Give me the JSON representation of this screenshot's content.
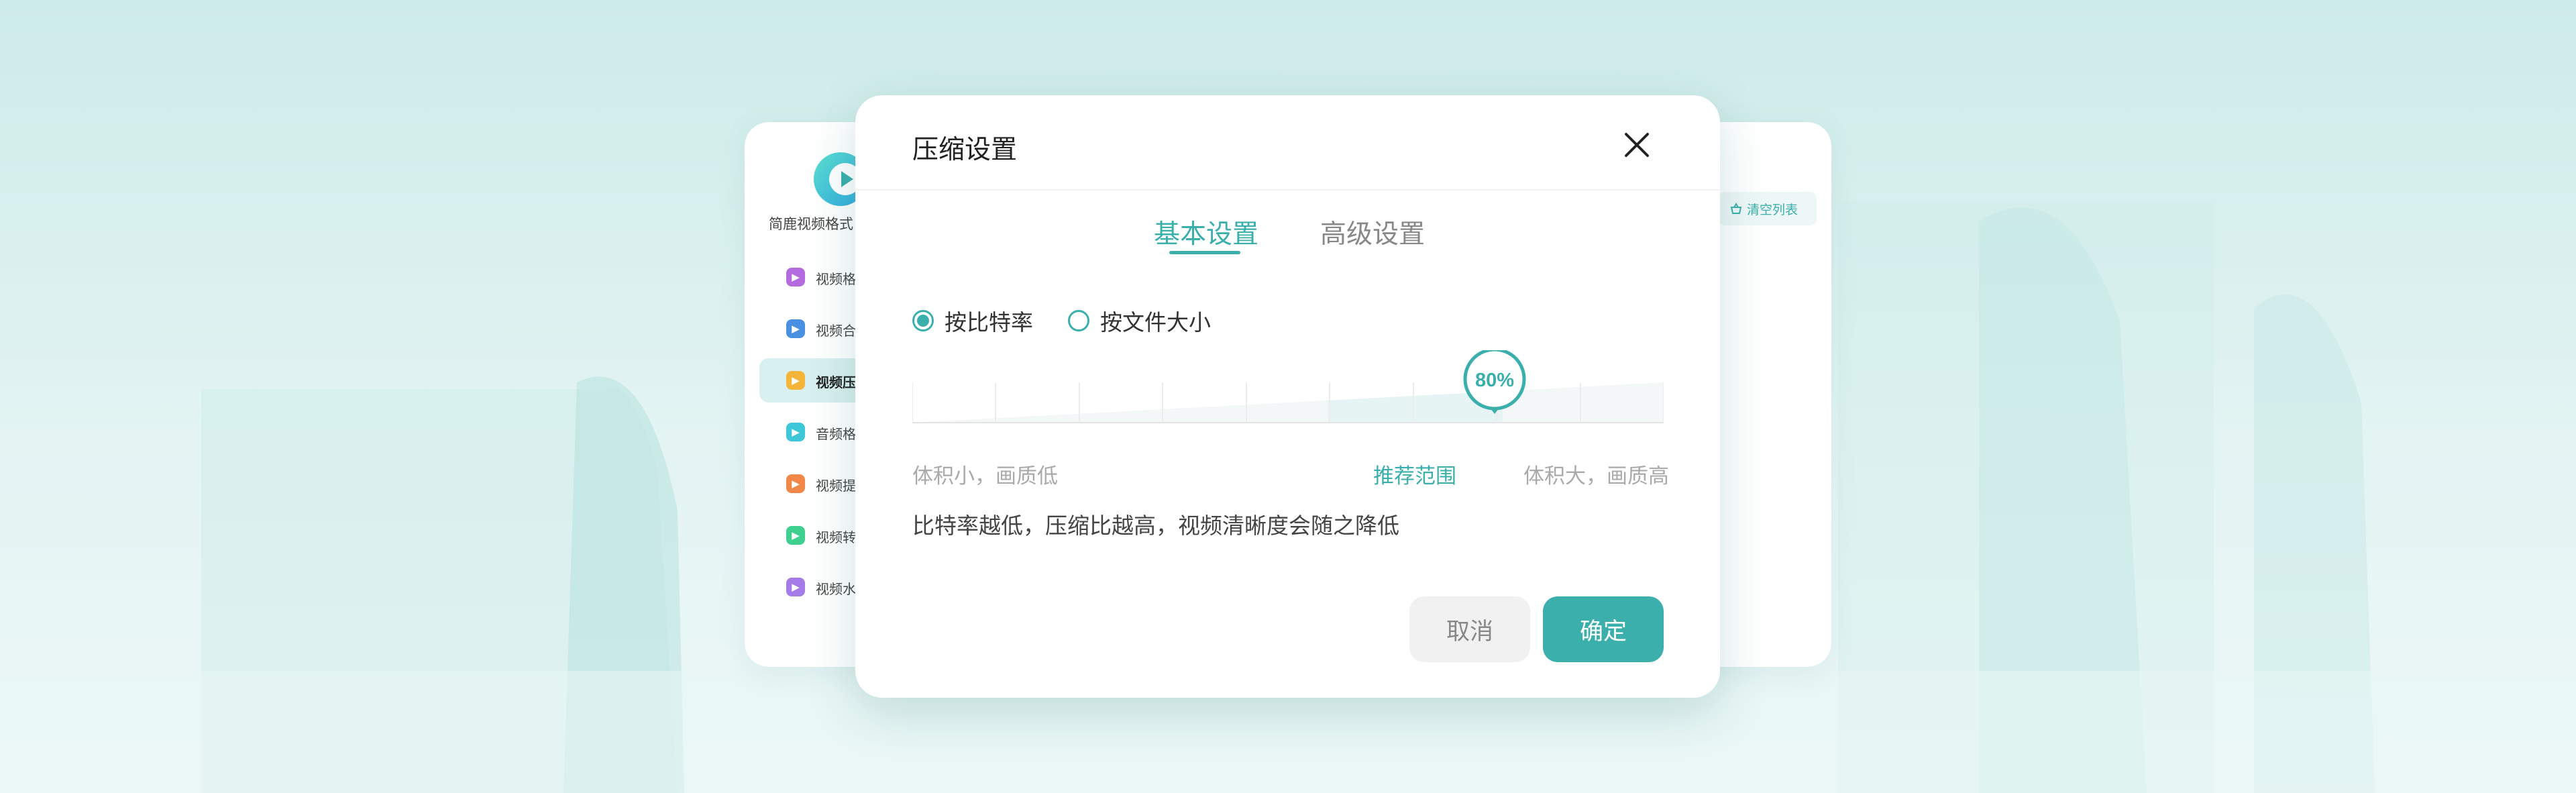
{
  "back_window": {
    "app_name": "简鹿视频格式",
    "sidebar_items": [
      {
        "label": "视频格式",
        "icon": "video-format-icon",
        "color": "#b56be0"
      },
      {
        "label": "视频合并",
        "icon": "video-merge-icon",
        "color": "#4a90e2"
      },
      {
        "label": "视频压缩",
        "icon": "video-compress-icon",
        "color": "#f5b43a"
      },
      {
        "label": "音频格式",
        "icon": "audio-format-icon",
        "color": "#3ec6d9"
      },
      {
        "label": "视频提取",
        "icon": "video-extract-icon",
        "color": "#f2874a"
      },
      {
        "label": "视频转G",
        "icon": "video-to-gif-icon",
        "color": "#3fcf8e"
      },
      {
        "label": "视频水印",
        "icon": "video-watermark-icon",
        "color": "#a57be8"
      }
    ],
    "active_index": 2,
    "clear_list_label": "清空列表"
  },
  "dialog": {
    "title": "压缩设置",
    "tabs": [
      {
        "label": "基本设置",
        "active": true
      },
      {
        "label": "高级设置",
        "active": false
      }
    ],
    "radio_options": [
      {
        "label": "按比特率",
        "selected": true
      },
      {
        "label": "按文件大小",
        "selected": false
      }
    ],
    "slider": {
      "value_label": "80%",
      "value": 0.7,
      "segments": 9,
      "left_label": "体积小，画质低",
      "recommended_label": "推荐范围",
      "right_label": "体积大，画质高"
    },
    "description": "比特率越低，压缩比越高，视频清晰度会随之降低",
    "cancel_label": "取消",
    "confirm_label": "确定"
  },
  "colors": {
    "accent": "#3aafac",
    "background": "#d4eeed"
  }
}
